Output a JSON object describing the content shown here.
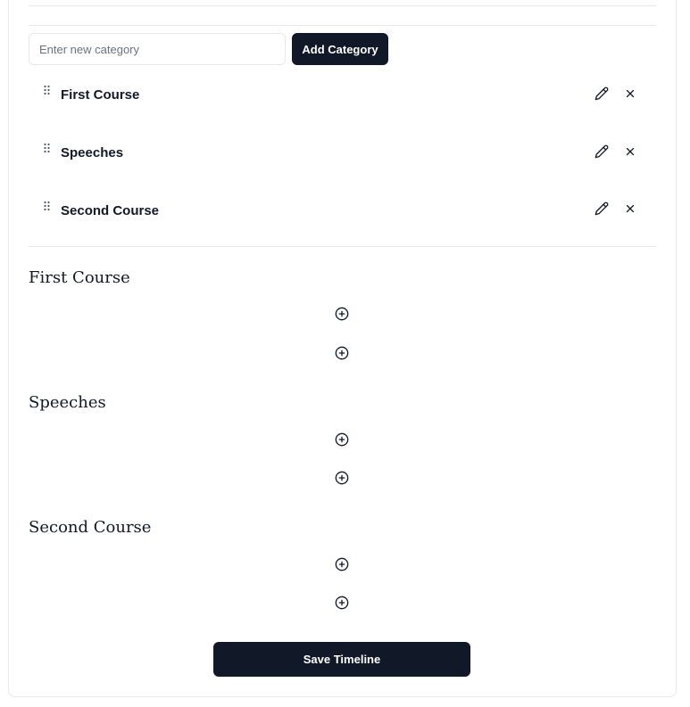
{
  "category_form": {
    "input_value": "",
    "input_placeholder": "Enter new category",
    "add_button_label": "Add Category"
  },
  "categories": [
    {
      "label": "First Course"
    },
    {
      "label": "Speeches"
    },
    {
      "label": "Second Course"
    }
  ],
  "timeline_sections": [
    {
      "title": "First Course",
      "add_actions": 2
    },
    {
      "title": "Speeches",
      "add_actions": 2
    },
    {
      "title": "Second Course",
      "add_actions": 2
    }
  ],
  "save_button_label": "Save Timeline",
  "colors": {
    "primary_button": "#111827",
    "border": "#e5e7eb",
    "text": "#111827",
    "placeholder": "#6b7280"
  },
  "icons": [
    "drag-handle-icon",
    "pencil-icon",
    "close-icon",
    "plus-circle-icon"
  ]
}
